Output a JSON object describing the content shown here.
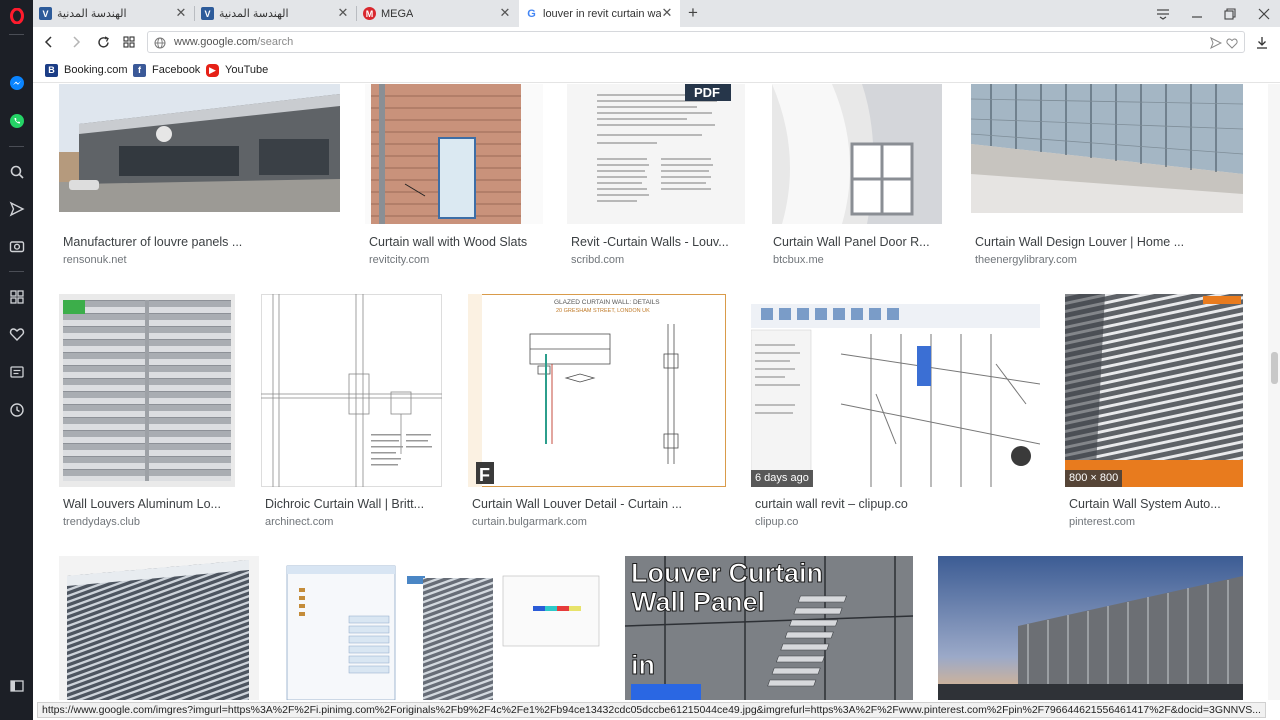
{
  "browser": {
    "tabs": [
      {
        "title": "الهندسة المدنية",
        "favicon": "arabic-site-icon",
        "active": false
      },
      {
        "title": "الهندسة المدنية",
        "favicon": "arabic-site-icon",
        "active": false
      },
      {
        "title": "MEGA",
        "favicon": "mega-icon",
        "active": false
      },
      {
        "title": "louver in revit curtain wall",
        "favicon": "google-icon",
        "active": true
      }
    ],
    "new_tab_label": "+",
    "address": {
      "host": "www.google.com",
      "path": "/search"
    },
    "bookmarks": [
      {
        "label": "Booking.com",
        "icon": "booking-icon",
        "color": "#1b3d86"
      },
      {
        "label": "Facebook",
        "icon": "facebook-icon",
        "color": "#3b5998"
      },
      {
        "label": "YouTube",
        "icon": "youtube-icon",
        "color": "#e62117"
      }
    ],
    "status_url": "https://www.google.com/imgres?imgurl=https%3A%2F%2Fi.pinimg.com%2Foriginals%2Fb9%2F4c%2Fe1%2Fb94ce13432cdc05dccbe61215044ce49.jpg&imgrefurl=https%3A%2F%2Fwww.pinterest.com%2Fpin%2F796644621556461417%2F&docid=3GNNVS..."
  },
  "results": {
    "row1": [
      {
        "caption": "Manufacturer of louvre panels ...",
        "source": "rensonuk.net"
      },
      {
        "caption": "Curtain wall with Wood Slats",
        "source": "revitcity.com"
      },
      {
        "caption": "Revit -Curtain Walls - Louv...",
        "source": "scribd.com",
        "overlay": "PDF"
      },
      {
        "caption": "Curtain Wall Panel Door R...",
        "source": "btcbux.me"
      },
      {
        "caption": "Curtain Wall Design Louver | Home ...",
        "source": "theenergylibrary.com"
      }
    ],
    "row2": [
      {
        "caption": "Wall Louvers Aluminum Lo...",
        "source": "trendydays.club"
      },
      {
        "caption": "Dichroic Curtain Wall | Britt...",
        "source": "archinect.com"
      },
      {
        "caption": "Curtain Wall Louver Detail - Curtain ...",
        "source": "curtain.bulgarmark.com"
      },
      {
        "caption": "curtain wall revit – clipup.co",
        "source": "clipup.co",
        "badge": "6 days ago"
      },
      {
        "caption": "Curtain Wall System Auto...",
        "source": "pinterest.com",
        "badge": "800 × 800"
      }
    ],
    "row3": [
      {
        "title_overlay_line1": "Louver Curtain",
        "title_overlay_line2": "Wall Panel",
        "title_overlay_line3": "in"
      }
    ],
    "drawing_header": "GLAZED CURTAIN WALL: DETAILS",
    "drawing_sub": "20 GRESHAM STREET, LONDON UK"
  }
}
